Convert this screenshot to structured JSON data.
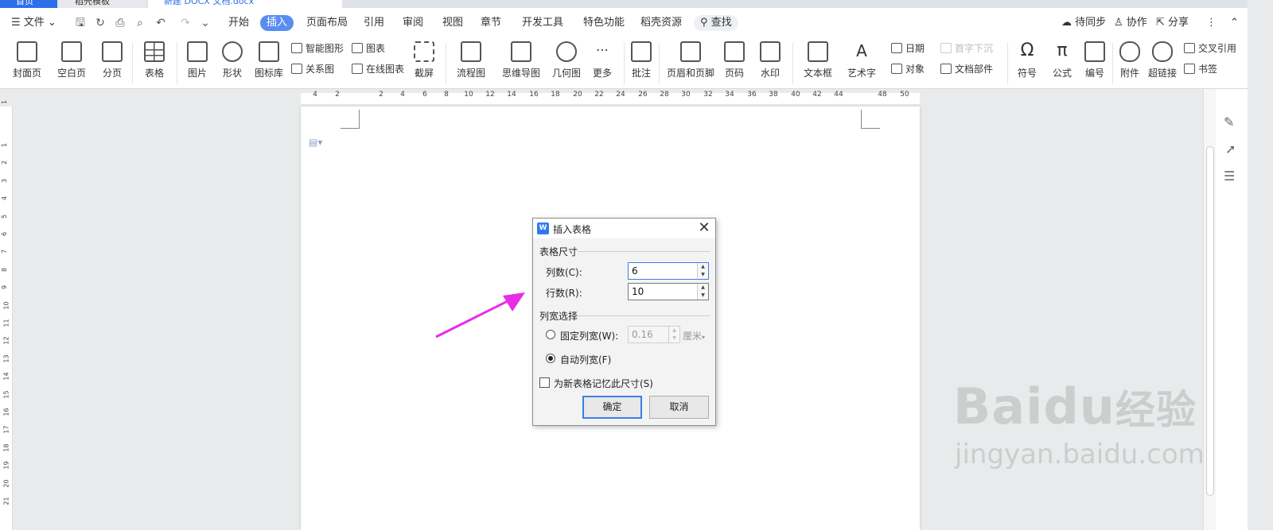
{
  "tabs": [
    {
      "label": "首页"
    },
    {
      "label": "稻壳模板"
    },
    {
      "label": "新建 DOCX 文档.docx"
    }
  ],
  "menubar": {
    "file": "文件",
    "items": [
      "开始",
      "插入",
      "页面布局",
      "引用",
      "审阅",
      "视图",
      "章节",
      "开发工具",
      "特色功能",
      "稻壳资源"
    ],
    "active": "插入",
    "search": "查找",
    "sync": "待同步",
    "collab": "协作",
    "share": "分享"
  },
  "ribbon": {
    "cover": "封面页",
    "blank": "空白页",
    "pagebreak": "分页",
    "table": "表格",
    "picture": "图片",
    "shape": "形状",
    "iconlib": "图标库",
    "smartart": "智能图形",
    "chart": "图表",
    "relation": "关系图",
    "onlinechart": "在线图表",
    "screenshot": "截屏",
    "flowchart": "流程图",
    "mindmap": "思维导图",
    "geometry": "几何图",
    "more": "更多",
    "comment": "批注",
    "headerfooter": "页眉和页脚",
    "pagenum": "页码",
    "watermark": "水印",
    "textbox": "文本框",
    "wordart": "艺术字",
    "date": "日期",
    "object": "对象",
    "dropcap": "首字下沉",
    "docparts": "文档部件",
    "symbol": "符号",
    "formula": "公式",
    "numbering": "编号",
    "attachment": "附件",
    "hyperlink": "超链接",
    "crossref": "交叉引用",
    "bookmark": "书签"
  },
  "ruler": [
    "4",
    "2",
    "2",
    "4",
    "6",
    "8",
    "10",
    "12",
    "14",
    "16",
    "18",
    "20",
    "22",
    "24",
    "26",
    "28",
    "30",
    "32",
    "34",
    "36",
    "38",
    "40",
    "42",
    "44",
    "48",
    "50"
  ],
  "vruler": [
    "1",
    "1",
    "2",
    "3",
    "4",
    "5",
    "6",
    "7",
    "8",
    "9",
    "10",
    "11",
    "12",
    "13",
    "14",
    "15",
    "16",
    "17",
    "18",
    "19",
    "20",
    "21"
  ],
  "dialog": {
    "title": "插入表格",
    "size_group": "表格尺寸",
    "cols_label": "列数(C):",
    "cols_value": "6",
    "rows_label": "行数(R):",
    "rows_value": "10",
    "width_group": "列宽选择",
    "fixed_label": "固定列宽(W):",
    "fixed_value": "0.16",
    "unit": "厘米",
    "auto_label": "自动列宽(F)",
    "remember_label": "为新表格记忆此尺寸(S)",
    "ok": "确定",
    "cancel": "取消"
  },
  "watermark": {
    "brand": "Baidu",
    "product": "经验",
    "url": "jingyan.baidu.com"
  },
  "colors": {
    "accent": "#5a8df0",
    "arrow": "#e62de8"
  }
}
